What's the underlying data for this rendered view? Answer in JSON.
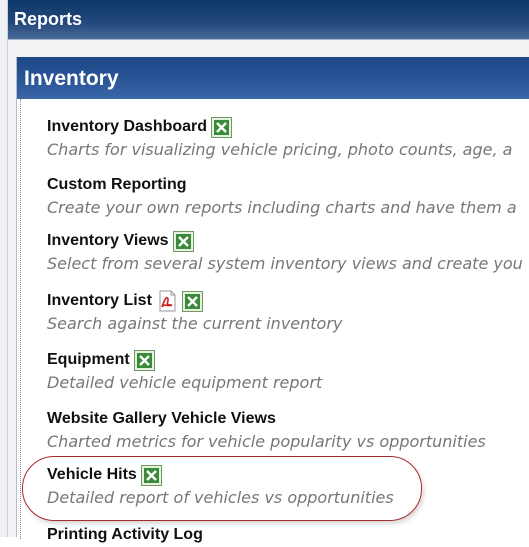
{
  "header": {
    "title": "Reports"
  },
  "section": {
    "title": "Inventory"
  },
  "items": [
    {
      "title": "Inventory Dashboard",
      "description": "Charts for visualizing vehicle pricing, photo counts, age, a",
      "icons": [
        "excel-icon"
      ]
    },
    {
      "title": "Custom Reporting",
      "description": "Create your own reports including charts and have them a",
      "icons": []
    },
    {
      "title": "Inventory Views",
      "description": "Select from several system inventory views and create you",
      "icons": [
        "excel-icon"
      ]
    },
    {
      "title": "Inventory List",
      "description": "Search against the current inventory",
      "icons": [
        "pdf-icon",
        "excel-icon"
      ]
    },
    {
      "title": "Equipment",
      "description": "Detailed vehicle equipment report",
      "icons": [
        "excel-icon"
      ]
    },
    {
      "title": "Website Gallery Vehicle Views",
      "description": "Charted metrics for vehicle popularity vs opportunities",
      "icons": []
    },
    {
      "title": "Vehicle Hits",
      "description": "Detailed report of vehicles vs opportunities",
      "icons": [
        "excel-icon"
      ]
    },
    {
      "title": "Printing Activity Log",
      "description": "",
      "icons": []
    }
  ],
  "colors": {
    "header_dark": "#0c3668",
    "panel_blue": "#2a5698",
    "highlight": "#a82b2b",
    "description_gray": "#777777"
  }
}
